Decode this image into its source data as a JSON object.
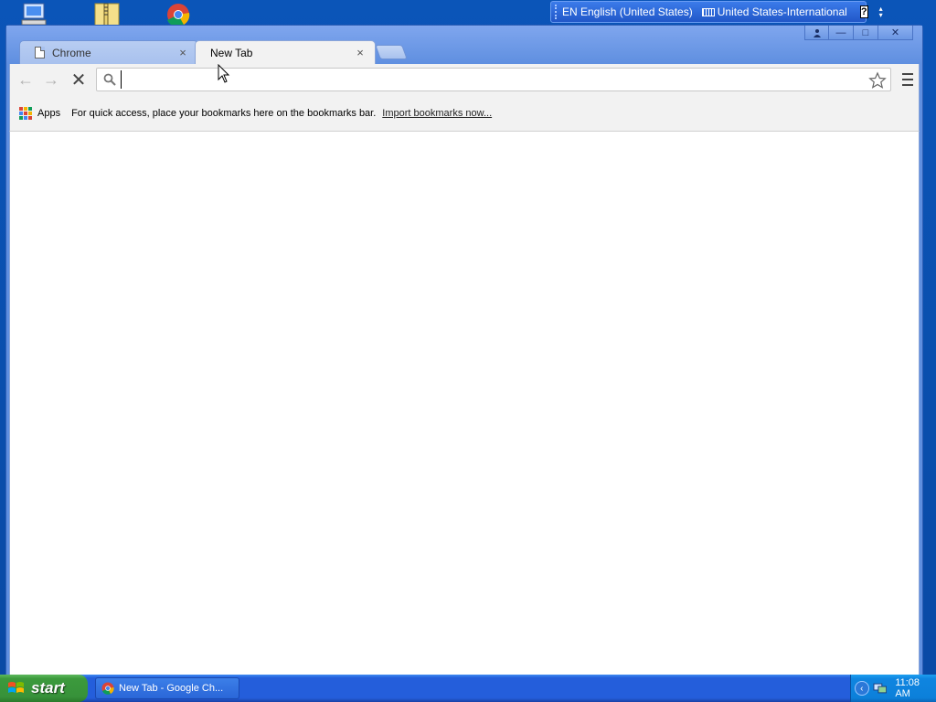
{
  "desktop": {
    "icons": [
      {
        "name": "my-computer-icon"
      },
      {
        "name": "zip-folder-icon"
      },
      {
        "name": "chrome-desktop-icon"
      }
    ]
  },
  "langbar": {
    "language": "EN English (United States)",
    "keyboard": "United States-International",
    "help": "?"
  },
  "window": {
    "tabs": [
      {
        "label": "Chrome",
        "close": "×"
      },
      {
        "label": "New Tab",
        "close": "×"
      }
    ],
    "controls": {
      "minimize": "—",
      "maximize": "□",
      "close": "✕"
    }
  },
  "toolbar": {
    "back": "←",
    "forward": "→",
    "stop": "✕",
    "omnibox_value": ""
  },
  "bookmarks": {
    "apps_label": "Apps",
    "hint": "For quick access, place your bookmarks here on the bookmarks bar.",
    "import_link": "Import bookmarks now..."
  },
  "taskbar": {
    "start_label": "start",
    "task_item": "New Tab - Google Ch...",
    "clock": "11:08 AM",
    "tray_chevron": "‹"
  },
  "colors": {
    "desktop": "#0a4aa5",
    "window_frame": "#5f8fe0",
    "start_green": "#3c9a3c",
    "taskbar_blue": "#245edb"
  }
}
